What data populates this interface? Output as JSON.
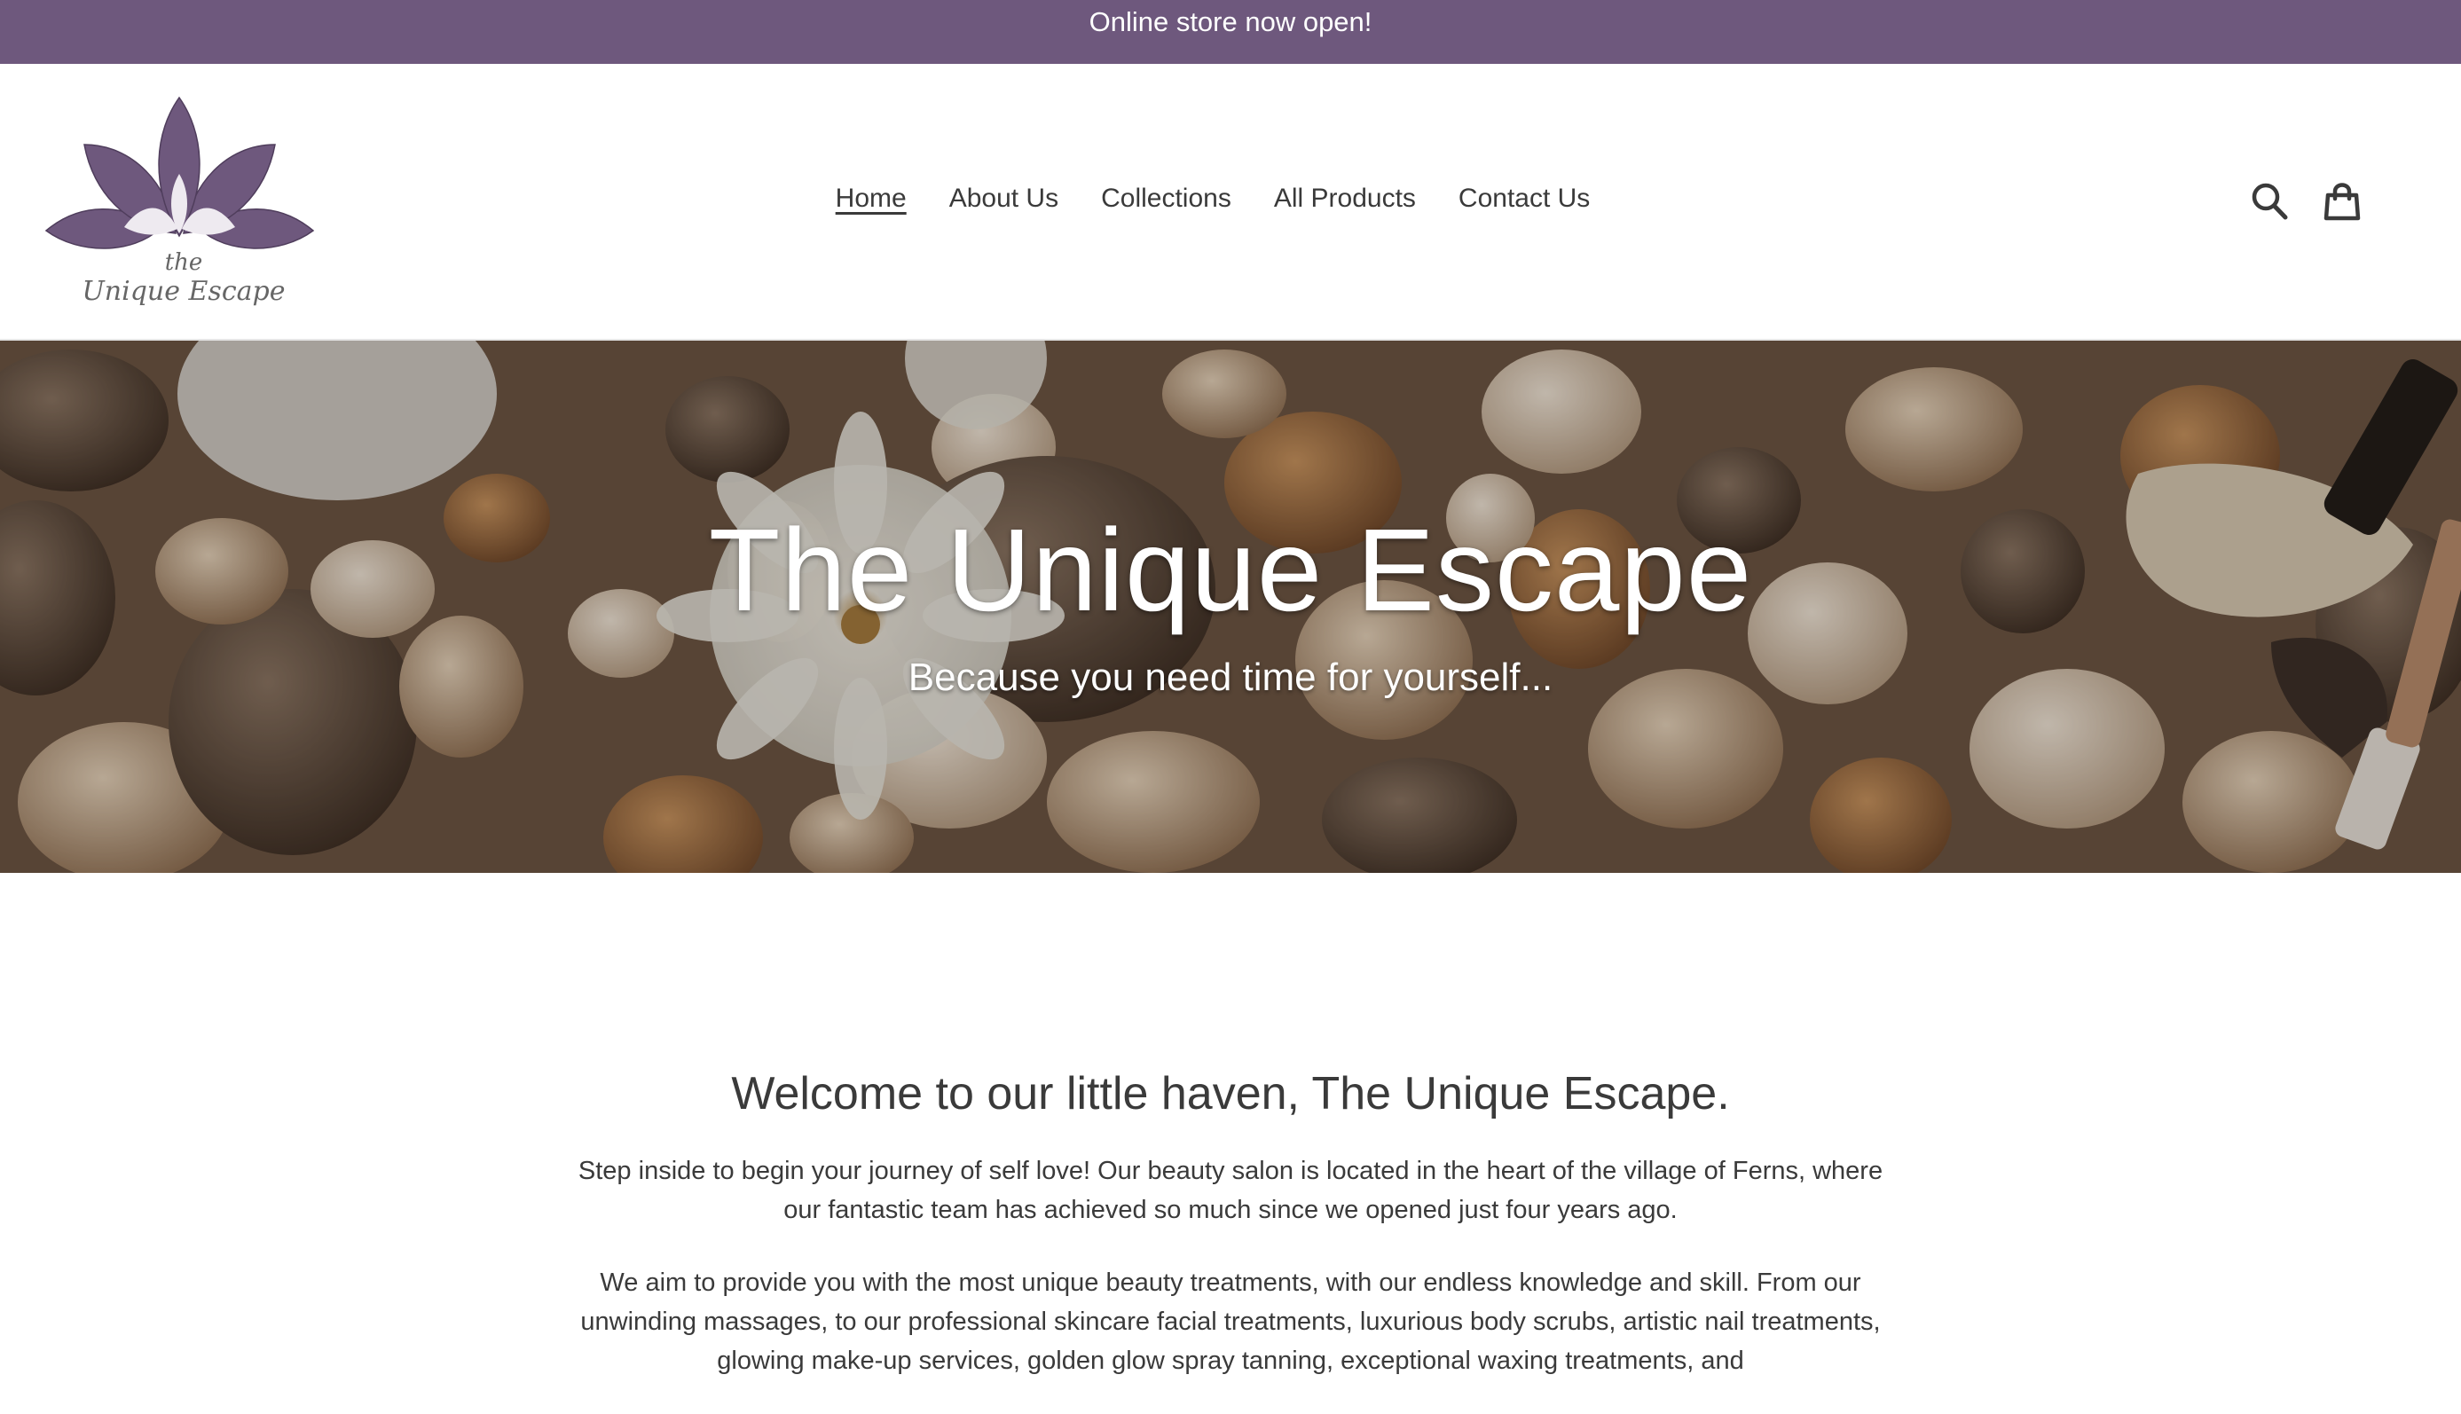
{
  "announcement": {
    "text": "Online store now open!"
  },
  "brand": {
    "logo_word_small": "the",
    "logo_word_name": "Unique Escape",
    "accent_color": "#6e587d"
  },
  "nav": {
    "items": [
      {
        "label": "Home",
        "active": true
      },
      {
        "label": "About Us",
        "active": false
      },
      {
        "label": "Collections",
        "active": false
      },
      {
        "label": "All Products",
        "active": false
      },
      {
        "label": "Contact Us",
        "active": false
      }
    ]
  },
  "header_icons": {
    "search": "search-icon",
    "cart": "cart-icon"
  },
  "hero": {
    "title": "The Unique Escape",
    "subtitle": "Because you need time for yourself..."
  },
  "welcome": {
    "heading": "Welcome to our little haven, The Unique Escape.",
    "paragraphs": [
      "Step inside to begin your journey of self love! Our beauty salon is located in the heart of the village of Ferns, where our fantastic team has achieved so much since we opened just four years ago.",
      "We aim to provide you with the most unique beauty treatments, with our endless knowledge and skill. From our unwinding massages, to our professional skincare facial treatments, luxurious body scrubs, artistic nail treatments, glowing make-up services, golden glow spray tanning, exceptional waxing treatments, and"
    ]
  }
}
